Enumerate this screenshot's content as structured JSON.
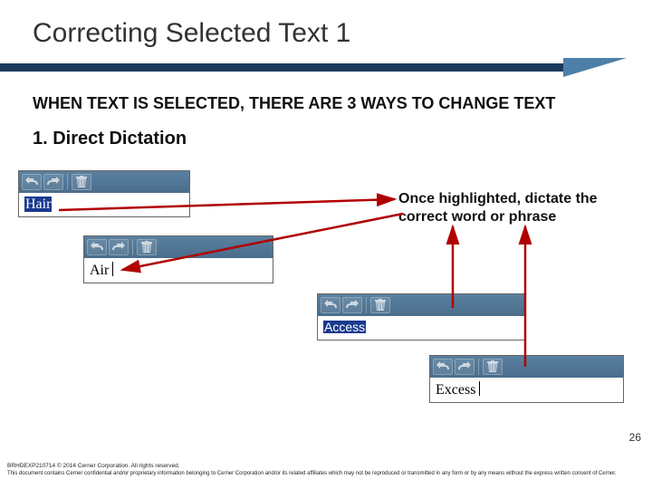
{
  "title": "Correcting Selected Text 1",
  "subhead": "WHEN TEXT IS SELECTED, THERE ARE 3 WAYS TO CHANGE TEXT",
  "item": "1.  Direct Dictation",
  "callout": "Once highlighted, dictate the correct word or phrase",
  "box1": {
    "text": "Hair"
  },
  "box2": {
    "text": "Air"
  },
  "box3": {
    "text": "Access"
  },
  "box4": {
    "text": "Excess"
  },
  "pagenum": "26",
  "footer1": "BRHDEXP210714    © 2014 Cerner Corporation. All rights reserved.",
  "footer2": "This document contains Cerner confidential and/or proprietary information belonging to Cerner Corporation and/or its related affiliates which may not be reproduced or transmitted in any form or by any means without the express written consent of Cerner."
}
